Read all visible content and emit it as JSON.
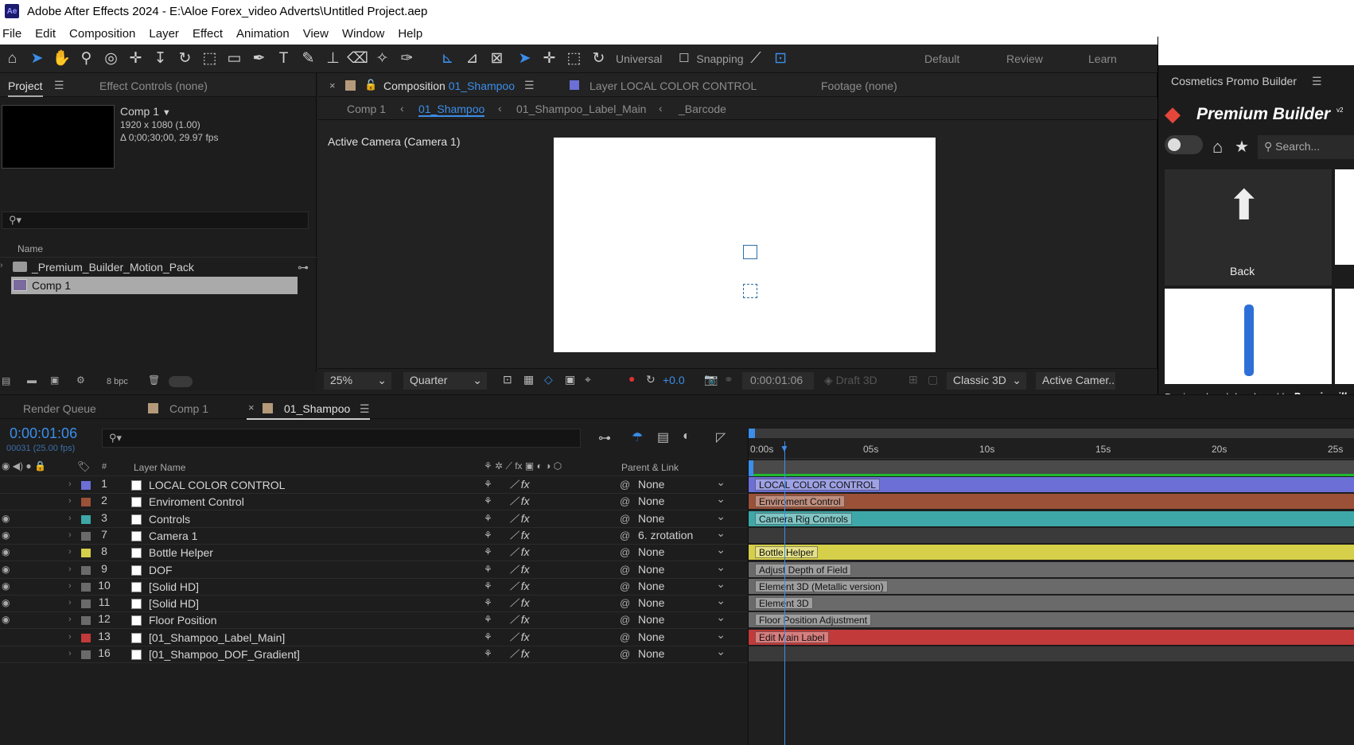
{
  "titlebar": {
    "app_icon": "Ae",
    "title": "Adobe After Effects 2024 - E:\\Aloe Forex_video Adverts\\Untitled Project.aep"
  },
  "menu": [
    "File",
    "Edit",
    "Composition",
    "Layer",
    "Effect",
    "Animation",
    "View",
    "Window",
    "Help"
  ],
  "toolbar": {
    "axis_mode": "Universal",
    "snapping": "Snapping",
    "workspaces": [
      "Default",
      "Review",
      "Learn"
    ]
  },
  "project": {
    "tab": "Project",
    "effect_controls": "Effect Controls (none)",
    "comp_name": "Comp 1",
    "comp_dims": "1920 x 1080 (1.00)",
    "comp_dur": "Δ 0;00;30;00, 29.97 fps",
    "col_name": "Name",
    "items": [
      "_Premium_Builder_Motion_Pack",
      "Comp 1"
    ],
    "bpc": "8 bpc"
  },
  "comp": {
    "tab_prefix": "Composition",
    "tab_name": "01_Shampoo",
    "layer_tab": "Layer  LOCAL COLOR CONTROL",
    "footage_tab": "Footage  (none)",
    "crumbs": [
      "Comp 1",
      "01_Shampoo",
      "01_Shampoo_Label_Main",
      "_Barcode"
    ],
    "camera": "Active Camera (Camera 1)",
    "zoom": "25%",
    "resolution": "Quarter",
    "exposure": "+0.0",
    "timecode": "0:00:01:06",
    "draft": "Draft 3D",
    "renderer": "Classic 3D",
    "view": "Active Camer..."
  },
  "plugin": {
    "title": "Cosmetics Promo Builder",
    "brand": "Premium Builder",
    "version": "v2",
    "search": "Search...",
    "back": "Back",
    "footer": "Designed and developed by",
    "footer_brand": "Premiumilk."
  },
  "timeline": {
    "tabs": [
      "Render Queue",
      "Comp 1",
      "01_Shampoo"
    ],
    "timecode": "0:00:01:06",
    "frames": "00031 (25.00 fps)",
    "col_num": "#",
    "col_name": "Layer Name",
    "col_parent": "Parent & Link",
    "ruler": [
      "0:00s",
      "05s",
      "10s",
      "15s",
      "20s",
      "25s"
    ],
    "layers": [
      {
        "num": "1",
        "name": "LOCAL COLOR CONTROL",
        "parent": "None",
        "bar": "LOCAL COLOR CONTROL",
        "color": "#6b6fd6",
        "eye": false
      },
      {
        "num": "2",
        "name": "Enviroment Control",
        "parent": "None",
        "bar": "Enviroment Control",
        "color": "#9b5138",
        "eye": false
      },
      {
        "num": "3",
        "name": "Controls",
        "parent": "None",
        "bar": "Camera Rig Controls",
        "color": "#3ea7a7",
        "eye": true
      },
      {
        "num": "7",
        "name": "Camera 1",
        "parent": "6. zrotation",
        "bar": "",
        "color": "#6a6a6a",
        "eye": true
      },
      {
        "num": "8",
        "name": "Bottle Helper",
        "parent": "None",
        "bar": "Bottle Helper",
        "color": "#d6cf4a",
        "eye": true
      },
      {
        "num": "9",
        "name": "DOF",
        "parent": "None",
        "bar": "Adjust Depth of Field",
        "color": "#6a6a6a",
        "eye": true
      },
      {
        "num": "10",
        "name": "[Solid HD]",
        "parent": "None",
        "bar": "Element 3D (Metallic version)",
        "color": "#6a6a6a",
        "eye": true
      },
      {
        "num": "11",
        "name": "[Solid HD]",
        "parent": "None",
        "bar": "Element 3D",
        "color": "#6a6a6a",
        "eye": true
      },
      {
        "num": "12",
        "name": "Floor Position",
        "parent": "None",
        "bar": "Floor Position Adjustment",
        "color": "#6a6a6a",
        "eye": true
      },
      {
        "num": "13",
        "name": "[01_Shampoo_Label_Main]",
        "parent": "None",
        "bar": "Edit Main Label",
        "color": "#c23a3a",
        "eye": false
      },
      {
        "num": "16",
        "name": "[01_Shampoo_DOF_Gradient]",
        "parent": "None",
        "bar": "",
        "color": "#6a6a6a",
        "eye": false
      }
    ]
  }
}
